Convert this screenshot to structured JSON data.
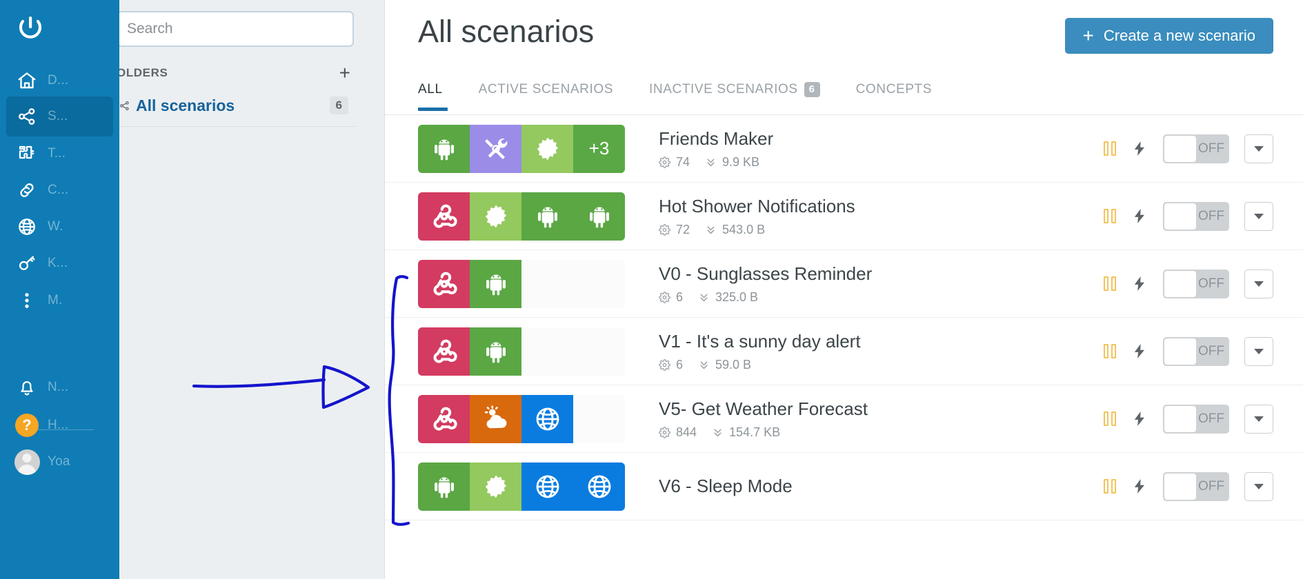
{
  "colors": {
    "rail_bg": "#0f7cb5",
    "rail_active": "#0a6b9e",
    "accent_blue": "#1a6fa8",
    "create_btn": "#3a8dbe",
    "panel_bg": "#eceff1",
    "annotation": "#1414cc",
    "android_green": "#5aa744",
    "android_green_light": "#7bbd4e",
    "gear_light_green": "#93c95e",
    "tools_purple": "#9b8ce8",
    "more_green": "#5aa845",
    "webhook_crimson": "#d33b61",
    "weather_orange": "#d9690d",
    "http_blue": "#0a7ce0",
    "pause_yellow": "#f1c45e",
    "toggle_track": "#cfd2d5"
  },
  "rail": {
    "logo_icon": "integromat-logo-icon",
    "items": [
      {
        "icon": "home-icon",
        "label": "D...",
        "active": false
      },
      {
        "icon": "share-nodes-icon",
        "label": "S...",
        "active": true
      },
      {
        "icon": "puzzle-icon",
        "label": "T...",
        "active": false
      },
      {
        "icon": "link-icon",
        "label": "C...",
        "active": false
      },
      {
        "icon": "globe-icon",
        "label": "W.",
        "active": false
      },
      {
        "icon": "key-icon",
        "label": "K...",
        "active": false
      },
      {
        "icon": "more-vertical-icon",
        "label": "M.",
        "active": false
      }
    ],
    "bottom_items": [
      {
        "icon": "bell-icon",
        "label": "N..."
      },
      {
        "icon": "help-icon",
        "label": "H..."
      },
      {
        "icon": "avatar-icon",
        "label": "Yoa"
      }
    ]
  },
  "search": {
    "placeholder": "Search",
    "value": ""
  },
  "folders": {
    "title": "OLDERS",
    "add_label": "+",
    "items": [
      {
        "icon": "share-small-icon",
        "label": "All scenarios",
        "count": "6",
        "active": true
      }
    ]
  },
  "header": {
    "title": "All scenarios",
    "create_button": {
      "plus": "+",
      "label": "Create a new scenario"
    }
  },
  "tabs": [
    {
      "label": "ALL",
      "badge": "",
      "active": true
    },
    {
      "label": "ACTIVE SCENARIOS",
      "badge": "",
      "active": false
    },
    {
      "label": "INACTIVE SCENARIOS",
      "badge": "6",
      "active": false
    },
    {
      "label": "CONCEPTS",
      "badge": "",
      "active": false
    }
  ],
  "scenarios": [
    {
      "name": "Friends Maker",
      "operations": "74",
      "data": "9.9 KB",
      "show_stats": true,
      "tiles": [
        {
          "kind": "android",
          "color": "#5aa744"
        },
        {
          "kind": "tools",
          "color": "#9b8ce8"
        },
        {
          "kind": "gear",
          "color": "#93c95e"
        },
        {
          "kind": "more",
          "color": "#5aa845",
          "text": "+3"
        }
      ],
      "controls": {
        "pause": "pause-icon",
        "bolt": "bolt-icon",
        "toggle": "OFF",
        "caret": "chevron-down-icon"
      }
    },
    {
      "name": "Hot Shower Notifications",
      "operations": "72",
      "data": "543.0 B",
      "show_stats": true,
      "tiles": [
        {
          "kind": "webhook",
          "color": "#d33b61"
        },
        {
          "kind": "gear",
          "color": "#93c95e"
        },
        {
          "kind": "android",
          "color": "#5aa744"
        },
        {
          "kind": "android",
          "color": "#5aa744"
        }
      ],
      "controls": {
        "pause": "pause-icon",
        "bolt": "bolt-icon",
        "toggle": "OFF",
        "caret": "chevron-down-icon"
      }
    },
    {
      "name": "V0 - Sunglasses Reminder",
      "operations": "6",
      "data": "325.0 B",
      "show_stats": true,
      "tiles": [
        {
          "kind": "webhook",
          "color": "#d33b61"
        },
        {
          "kind": "android",
          "color": "#5aa744"
        },
        {
          "kind": "blank",
          "color": "#fbfbfb"
        },
        {
          "kind": "blank",
          "color": "#fbfbfb"
        }
      ],
      "controls": {
        "pause": "pause-icon",
        "bolt": "bolt-icon",
        "toggle": "OFF",
        "caret": "chevron-down-icon"
      }
    },
    {
      "name": "V1 - It's a sunny day alert",
      "operations": "6",
      "data": "59.0 B",
      "show_stats": true,
      "tiles": [
        {
          "kind": "webhook",
          "color": "#d33b61"
        },
        {
          "kind": "android",
          "color": "#5aa744"
        },
        {
          "kind": "blank",
          "color": "#fbfbfb"
        },
        {
          "kind": "blank",
          "color": "#fbfbfb"
        }
      ],
      "controls": {
        "pause": "pause-icon",
        "bolt": "bolt-icon",
        "toggle": "OFF",
        "caret": "chevron-down-icon"
      }
    },
    {
      "name": "V5- Get Weather Forecast",
      "operations": "844",
      "data": "154.7 KB",
      "show_stats": true,
      "tiles": [
        {
          "kind": "webhook",
          "color": "#d33b61"
        },
        {
          "kind": "weather",
          "color": "#d9690d"
        },
        {
          "kind": "globe",
          "color": "#0a7ce0"
        },
        {
          "kind": "blank",
          "color": "#fbfbfb"
        }
      ],
      "controls": {
        "pause": "pause-icon",
        "bolt": "bolt-icon",
        "toggle": "OFF",
        "caret": "chevron-down-icon"
      }
    },
    {
      "name": "V6 -  Sleep Mode",
      "operations": "",
      "data": "",
      "show_stats": false,
      "tiles": [
        {
          "kind": "android",
          "color": "#5aa744"
        },
        {
          "kind": "gear",
          "color": "#93c95e"
        },
        {
          "kind": "globe",
          "color": "#0a7ce0"
        },
        {
          "kind": "globe",
          "color": "#0a7ce0"
        }
      ],
      "controls": {
        "pause": "pause-icon",
        "bolt": "bolt-icon",
        "toggle": "OFF",
        "caret": "chevron-down-icon"
      }
    }
  ],
  "annotations": [
    {
      "name": "arrow-annotation",
      "shape": "hand-drawn-arrow-right"
    },
    {
      "name": "bracket-annotation",
      "shape": "hand-drawn-left-bracket"
    }
  ]
}
